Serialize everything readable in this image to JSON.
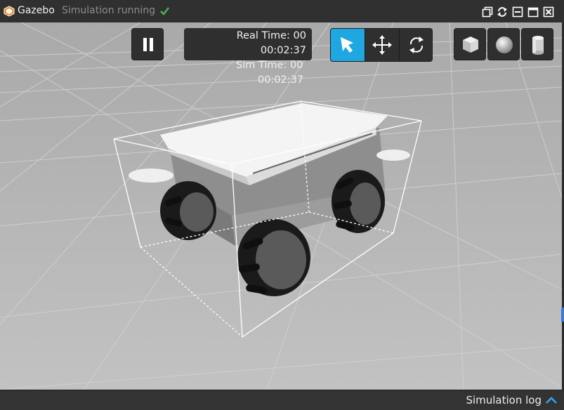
{
  "window": {
    "title": "Gazebo",
    "status": "Simulation running"
  },
  "toolbar": {
    "real_time_label": "Real Time: 00",
    "real_time_value": "00:02:37",
    "sim_time_label": "Sim Time: 00",
    "sim_time_value": "00:02:37",
    "active_mode": "select",
    "modes": [
      "select-mode-icon",
      "translate-mode-icon",
      "rotate-mode-icon"
    ],
    "shapes": [
      "box-icon",
      "sphere-icon",
      "cylinder-icon"
    ]
  },
  "statusbar": {
    "log_label": "Simulation log"
  },
  "colors": {
    "accent": "#1ea7e1",
    "ok": "#4caf50",
    "panel": "#2f2f2f"
  }
}
